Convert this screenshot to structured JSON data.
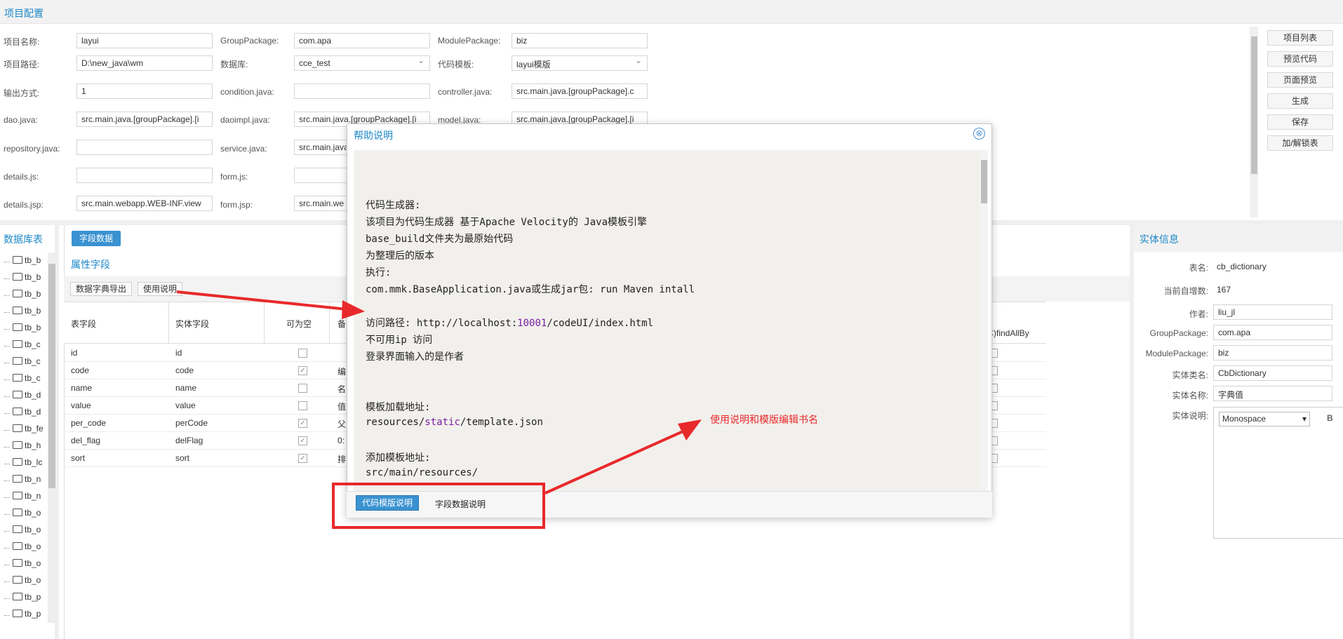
{
  "top": {
    "title": "项目配置",
    "fields": [
      {
        "label": "项目名称:",
        "value": "layui"
      },
      {
        "label": "GroupPackage:",
        "value": "com.apa"
      },
      {
        "label": "ModulePackage:",
        "value": "biz"
      },
      {
        "label": "项目路径:",
        "value": "D:\\new_java\\wm"
      },
      {
        "label": "数据库:",
        "value": "cce_test"
      },
      {
        "label": "代码模板:",
        "value": "layui模版"
      },
      {
        "label": "输出方式:",
        "value": "1"
      },
      {
        "label": "condition.java:",
        "value": ""
      },
      {
        "label": "controller.java:",
        "value": "src.main.java.[groupPackage].c"
      },
      {
        "label": "dao.java:",
        "value": "src.main.java.[groupPackage].[i"
      },
      {
        "label": "daoimpl.java:",
        "value": "src.main.java.[groupPackage].[i"
      },
      {
        "label": "model.java:",
        "value": "src.main.java.[groupPackage].[i"
      },
      {
        "label": "repository.java:",
        "value": ""
      },
      {
        "label": "service.java:",
        "value": "src.main.java"
      },
      {
        "label": "details.js:",
        "value": ""
      },
      {
        "label": "form.js:",
        "value": ""
      },
      {
        "label": "details.jsp:",
        "value": "src.main.webapp.WEB-INF.view"
      },
      {
        "label": "form.jsp:",
        "value": "src.main.we"
      }
    ],
    "buttons": [
      "项目列表",
      "预览代码",
      "页面预览",
      "生成",
      "保存",
      "加/解锁表"
    ]
  },
  "db": {
    "title": "数据库表",
    "items": [
      "tb_b",
      "tb_b",
      "tb_b",
      "tb_b",
      "tb_b",
      "tb_c",
      "tb_c",
      "tb_c",
      "tb_d",
      "tb_d",
      "tb_fe",
      "tb_h",
      "tb_lc",
      "tb_n",
      "tb_n",
      "tb_o",
      "tb_o",
      "tb_o",
      "tb_o",
      "tb_o",
      "tb_p",
      "tb_p"
    ]
  },
  "center": {
    "tab": "字段数据",
    "attr_title": "属性字段",
    "tool_export": "数据字典导出",
    "tool_help": "使用说明",
    "headers": {
      "col1": "表字段",
      "col2": "实体字段",
      "col3": "可为空",
      "col4": "备",
      "col_last": "(本)findAllBy"
    },
    "rows": [
      {
        "field": "id",
        "entity": "id",
        "nullable": false,
        "note": ""
      },
      {
        "field": "code",
        "entity": "code",
        "nullable": true,
        "note": "编"
      },
      {
        "field": "name",
        "entity": "name",
        "nullable": false,
        "note": "名"
      },
      {
        "field": "value",
        "entity": "value",
        "nullable": false,
        "note": "值"
      },
      {
        "field": "per_code",
        "entity": "perCode",
        "nullable": true,
        "note": "父"
      },
      {
        "field": "del_flag",
        "entity": "delFlag",
        "nullable": true,
        "note": "0:"
      },
      {
        "field": "sort",
        "entity": "sort",
        "nullable": true,
        "note": "排"
      }
    ]
  },
  "entity": {
    "title": "实体信息",
    "table_label": "表名:",
    "table_value": "cb_dictionary",
    "auto_label": "当前自增数:",
    "auto_value": "167",
    "author_label": "作者:",
    "author_value": "liu_jl",
    "group_label": "GroupPackage:",
    "group_value": "com.apa",
    "module_label": "ModulePackage:",
    "module_value": "biz",
    "class_label": "实体类名:",
    "class_value": "CbDictionary",
    "name_label": "实体名称:",
    "name_value": "字典值",
    "desc_label": "实体说明:",
    "font": "Monospace",
    "bold": "B"
  },
  "dialog": {
    "title": "帮助说明",
    "close": "⊗",
    "lines": {
      "l1": "代码生成器:",
      "l2": "该项目为代码生成器 基于Apache Velocity的 Java模板引擎",
      "l3": "base_build文件夹为最原始代码",
      "l4": "为整理后的版本",
      "l5": "执行:",
      "l6": "com.mmk.BaseApplication.java或生成jar包: run Maven intall",
      "l7a": "访问路径: ",
      "l7b": "http",
      "l7c": "://localhost:",
      "l7d": "10001",
      "l7e": "/codeUI/index.html",
      "l8": "不可用ip 访问",
      "l9": "登录界面输入的是作者",
      "l10": "模板加载地址:",
      "l11a": "resources/",
      "l11b": "static",
      "l11c": "/template.json",
      "l12": "添加模板地址:",
      "l13": "src/main/resources/"
    },
    "tab_template": "代码模版说明",
    "tab_field": "字段数据说明"
  },
  "annotation": {
    "text": "使用说明和模版编辑书名",
    "color": "#e8292b"
  }
}
